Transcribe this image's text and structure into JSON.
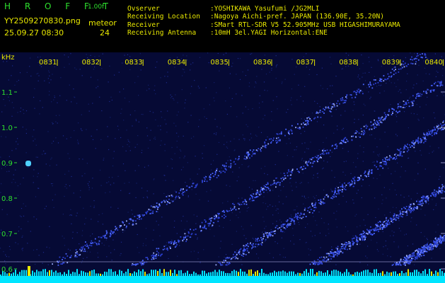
{
  "header": {
    "app_name": "H R O F F T",
    "version": "1.00f",
    "filename": "YY2509270830.png",
    "datetime": "25.09.27 08:30",
    "event_label": "meteor",
    "event_count": "24",
    "info": [
      {
        "label": "Ovserver",
        "value": ":YOSHIKAWA Yasufumi /JG2MLI"
      },
      {
        "label": "Receiving Location",
        "value": ":Nagoya Aichi-pref. JAPAN (136.90E, 35.20N)"
      },
      {
        "label": "Receiver",
        "value": ":SMart RTL-SDR V5 52.905MHz USB HIGASHIMURAYAMA"
      },
      {
        "label": "Receiving Antenna",
        "value": ":10mH 3el.YAGI Horizontal:ENE"
      }
    ]
  },
  "spectrogram": {
    "y_unit": "kHz",
    "y_ticks": [
      "1.1",
      "1.0",
      "0.9",
      "0.8",
      "0.7",
      "0.6"
    ],
    "y_values": [
      1.1,
      1.0,
      0.9,
      0.8,
      0.7,
      0.6
    ],
    "x_ticks": [
      "0831",
      "0832",
      "0833",
      "0834",
      "0835",
      "0836",
      "0837",
      "0838",
      "0839",
      "0840"
    ],
    "colors": {
      "background": "#060a35",
      "trace": "#3a5cff",
      "tick_text": "#e8e800",
      "axis_text": "#2ee02e",
      "baseline": "#00e5ff"
    }
  }
}
